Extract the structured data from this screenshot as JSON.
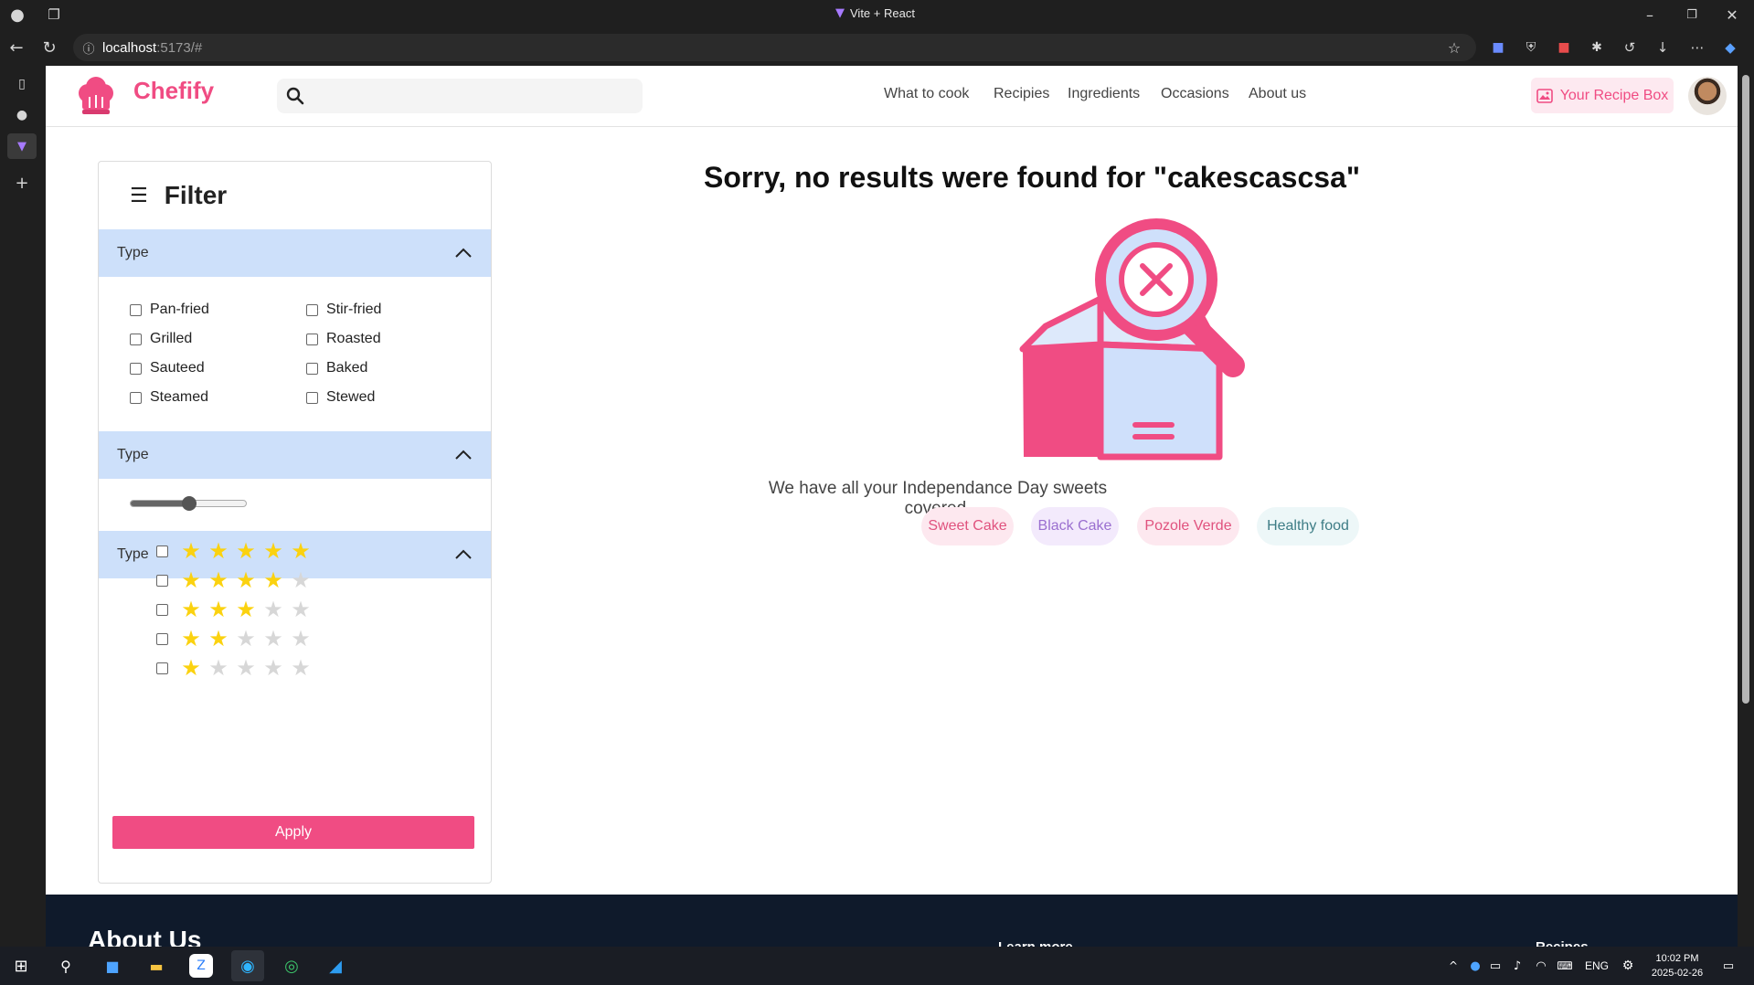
{
  "browser": {
    "window_title": "Vite + React",
    "url_host": "localhost",
    "url_rest": ":5173/#"
  },
  "header": {
    "brand": "Chefify",
    "search_placeholder": "",
    "nav": [
      "What to cook",
      "Recipies",
      "Ingredients",
      "Occasions",
      "About us"
    ],
    "recipe_box_label": "Your Recipe Box"
  },
  "filter": {
    "title": "Filter",
    "sections": [
      {
        "title": "Type"
      },
      {
        "title": "Type"
      },
      {
        "title": "Type"
      }
    ],
    "cooking_types": [
      "Pan-fried",
      "Stir-fried",
      "Grilled",
      "Roasted",
      "Sauteed",
      "Baked",
      "Steamed",
      "Stewed"
    ],
    "slider_value": 0.5,
    "ratings": [
      5,
      4,
      3,
      2,
      1
    ],
    "apply_label": "Apply"
  },
  "results": {
    "message": "Sorry, no results were found for \"cakescascsa\"",
    "subtitle": "We have all your Independance Day sweets covered.",
    "chips": [
      "Sweet Cake",
      "Black Cake",
      "Pozole Verde",
      "Healthy food"
    ]
  },
  "footer": {
    "heading": "About Us",
    "col2": "Learn more",
    "col3": "Recipes"
  },
  "taskbar": {
    "lang": "ENG",
    "time": "10:02 PM",
    "date": "2025-02-26"
  },
  "colors": {
    "brand": "#f04c83",
    "section_header": "#cde0fa",
    "star": "#fbd20f",
    "star_empty": "#d7d7d7"
  }
}
